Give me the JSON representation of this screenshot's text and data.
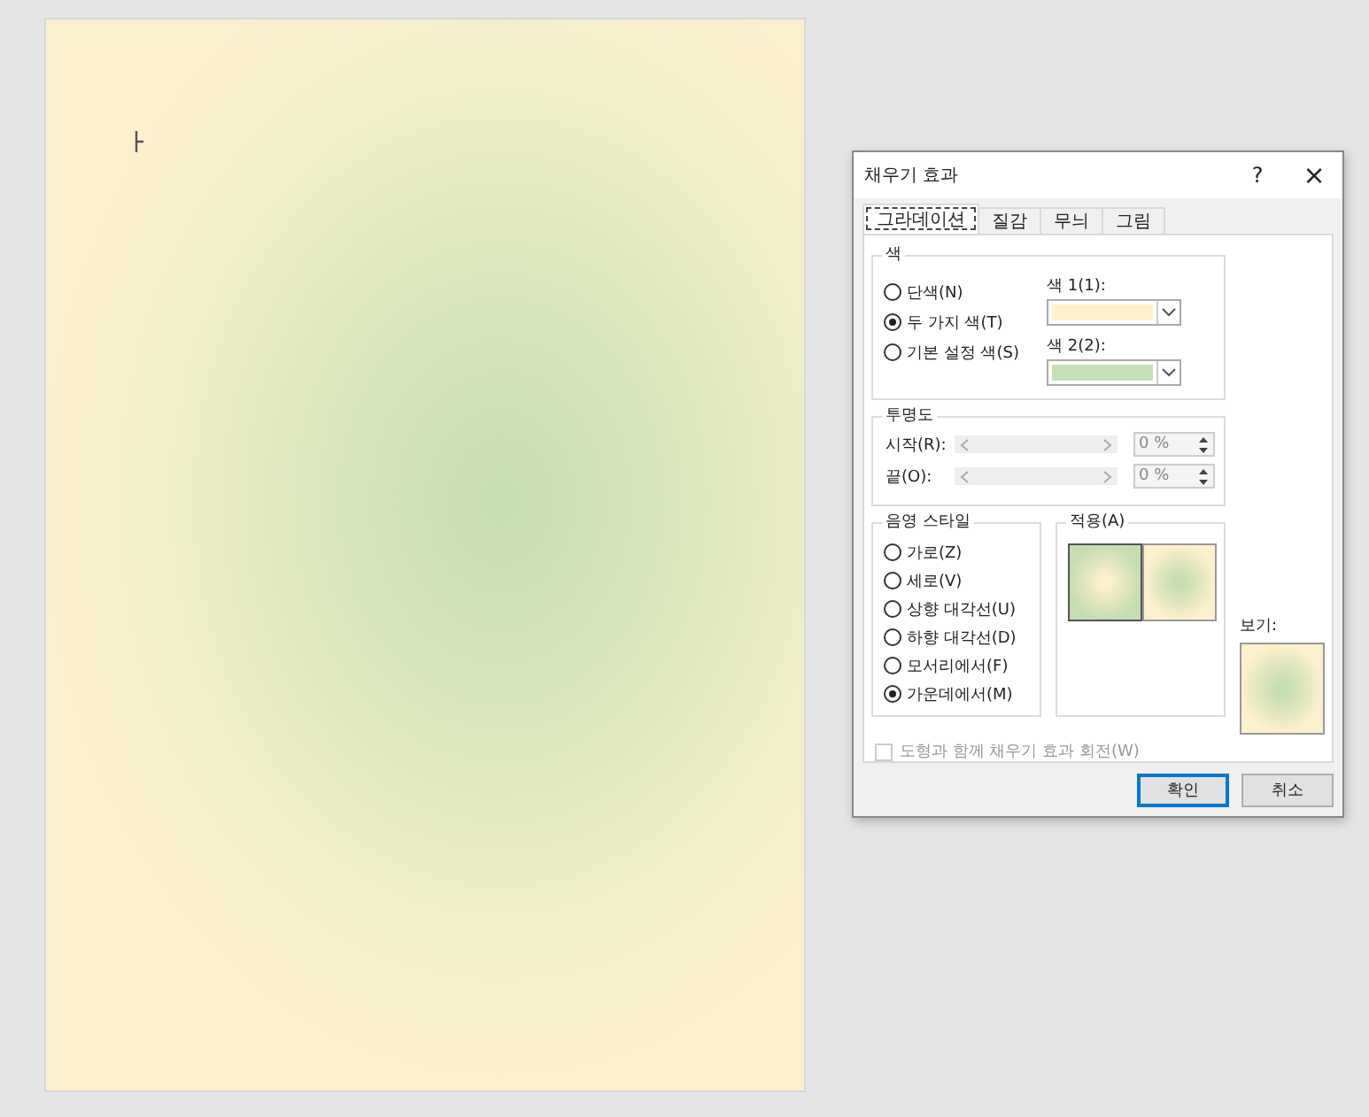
{
  "dialog": {
    "title": "채우기 효과",
    "help": "?",
    "close": "×"
  },
  "tabs": [
    {
      "label": "그라데이션",
      "selected": true
    },
    {
      "label": "질감",
      "selected": false
    },
    {
      "label": "무늬",
      "selected": false
    },
    {
      "label": "그림",
      "selected": false
    }
  ],
  "colors_group": {
    "label": "색",
    "options": [
      {
        "label": "단색(N)",
        "selected": false
      },
      {
        "label": "두 가지 색(T)",
        "selected": true
      },
      {
        "label": "기본 설정 색(S)",
        "selected": false
      }
    ],
    "pickers": [
      {
        "label": "색 1(1):",
        "color": "#fff2cc"
      },
      {
        "label": "색 2(2):",
        "color": "#c5e0b4"
      }
    ]
  },
  "transparency": {
    "label": "투명도",
    "rows": [
      {
        "label": "시작(R):",
        "value": "0 %",
        "disabled": true
      },
      {
        "label": "끝(O):",
        "value": "0 %",
        "disabled": true
      }
    ]
  },
  "shading_styles": {
    "label": "음영 스타일",
    "options": [
      {
        "label": "가로(Z)",
        "selected": false
      },
      {
        "label": "세로(V)",
        "selected": false
      },
      {
        "label": "상향 대각선(U)",
        "selected": false
      },
      {
        "label": "하향 대각선(D)",
        "selected": false
      },
      {
        "label": "모서리에서(F)",
        "selected": false
      },
      {
        "label": "가운데에서(M)",
        "selected": true
      }
    ]
  },
  "variants": {
    "label": "적용(A)",
    "items": [
      {
        "kind": "outward",
        "selected": true
      },
      {
        "kind": "inward",
        "selected": false
      }
    ]
  },
  "preview": {
    "label": "보기:"
  },
  "rotate": {
    "label": "도형과 함께 채우기 효과 회전(W)",
    "checked": false,
    "disabled": true
  },
  "buttons": [
    {
      "label": "확인",
      "default": true
    },
    {
      "label": "취소",
      "default": false
    }
  ]
}
